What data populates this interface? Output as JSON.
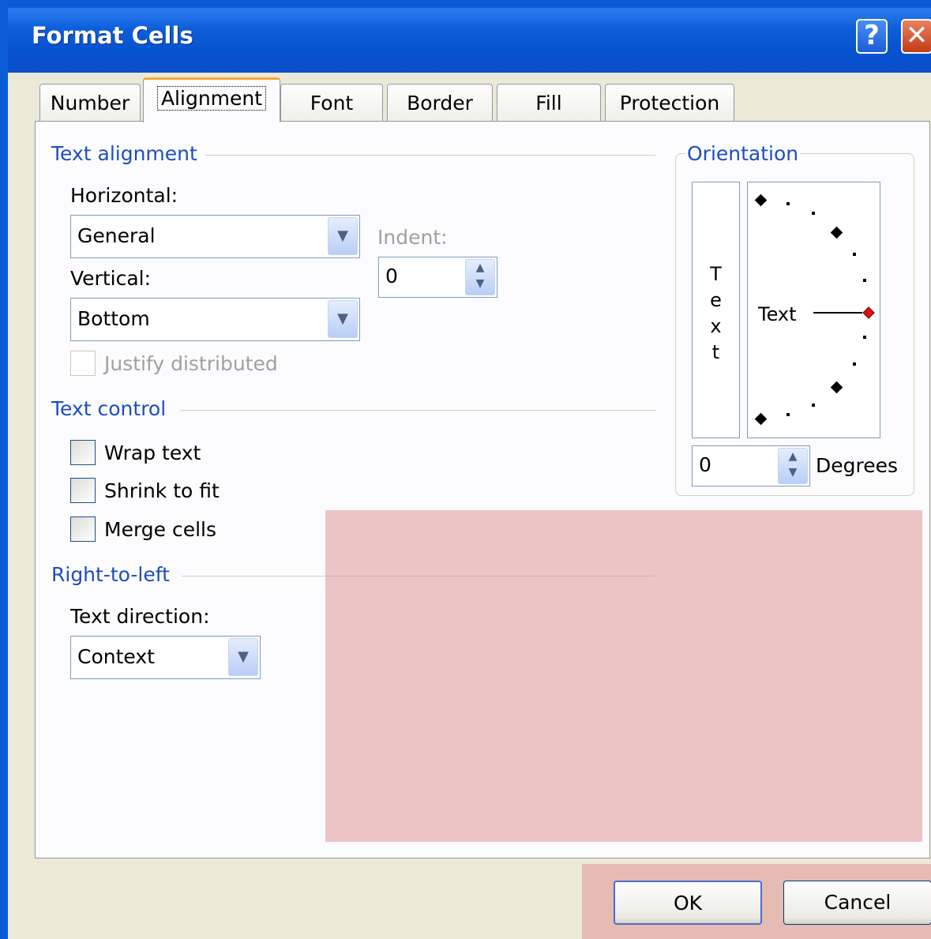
{
  "window": {
    "title": "Format Cells",
    "help_glyph": "?",
    "close_glyph": "✕"
  },
  "tabs": [
    {
      "label": "Number"
    },
    {
      "label": "Alignment",
      "active": true
    },
    {
      "label": "Font"
    },
    {
      "label": "Border"
    },
    {
      "label": "Fill"
    },
    {
      "label": "Protection"
    }
  ],
  "text_alignment": {
    "group_label": "Text alignment",
    "horizontal_label": "Horizontal:",
    "horizontal_value": "General",
    "vertical_label": "Vertical:",
    "vertical_value": "Bottom",
    "indent_label": "Indent:",
    "indent_value": "0",
    "justify_distributed_label": "Justify distributed"
  },
  "text_control": {
    "group_label": "Text control",
    "wrap_text_label": "Wrap text",
    "shrink_to_fit_label": "Shrink to fit",
    "merge_cells_label": "Merge cells"
  },
  "right_to_left": {
    "group_label": "Right-to-left",
    "text_direction_label": "Text direction:",
    "text_direction_value": "Context"
  },
  "orientation": {
    "group_label": "Orientation",
    "vertical_text_letters": [
      "T",
      "e",
      "x",
      "t"
    ],
    "dial_text": "Text",
    "degrees_value": "0",
    "degrees_label": "Degrees"
  },
  "buttons": {
    "ok_label": "OK",
    "cancel_label": "Cancel"
  },
  "colors": {
    "titlebar": "#0a5bd6",
    "group_label": "#1d4ebd",
    "active_tab_accent": "#f7a833",
    "dial_marker": "#e01010"
  }
}
